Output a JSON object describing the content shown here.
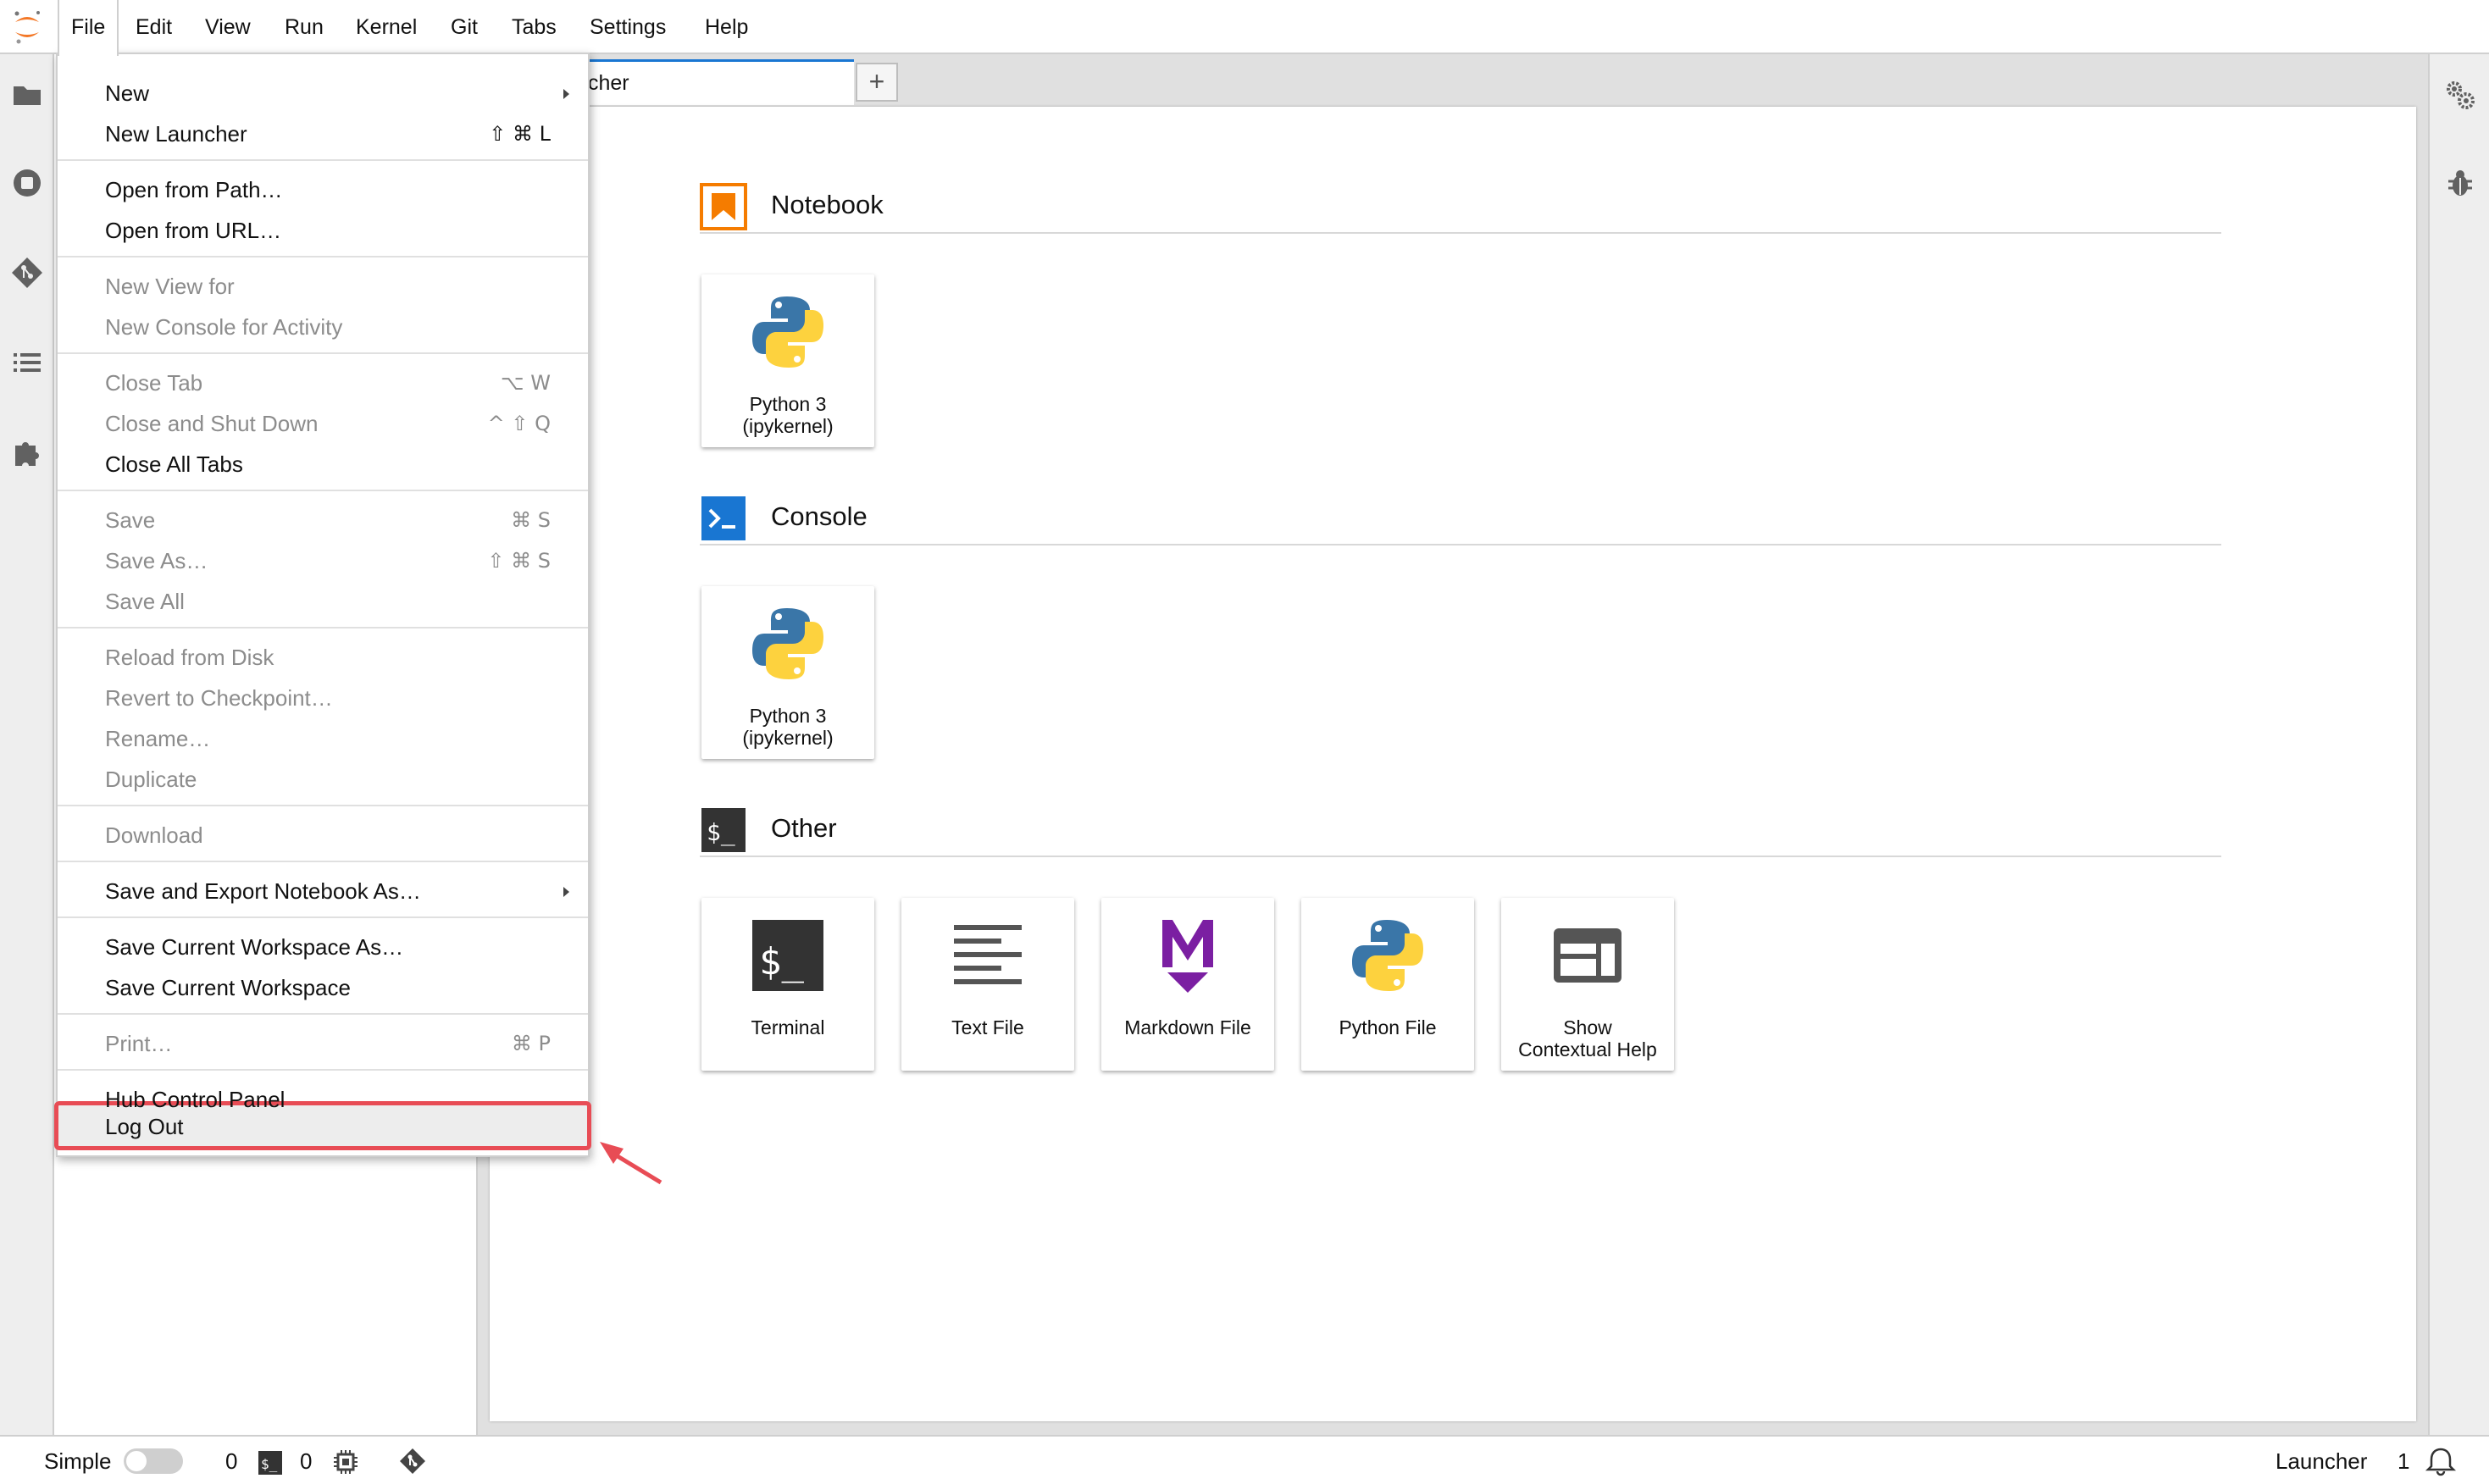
{
  "menubar": {
    "items": [
      "File",
      "Edit",
      "View",
      "Run",
      "Kernel",
      "Git",
      "Tabs",
      "Settings",
      "Help"
    ]
  },
  "tabs": {
    "launcher_label": "cher",
    "add_label": "+"
  },
  "launcher": {
    "sections": [
      {
        "title": "Notebook",
        "icon": "notebook-icon",
        "color": "#f57c00",
        "cards": [
          {
            "label_line1": "Python 3",
            "label_line2": "(ipykernel)",
            "icon": "python-logo"
          }
        ]
      },
      {
        "title": "Console",
        "icon": "console-icon",
        "color": "#1976d2",
        "cards": [
          {
            "label_line1": "Python 3",
            "label_line2": "(ipykernel)",
            "icon": "python-logo"
          }
        ]
      },
      {
        "title": "Other",
        "icon": "terminal-section-icon",
        "color": "#333333",
        "cards": [
          {
            "label_line1": "Terminal",
            "label_line2": "",
            "icon": "terminal-icon"
          },
          {
            "label_line1": "Text File",
            "label_line2": "",
            "icon": "text-file-icon"
          },
          {
            "label_line1": "Markdown File",
            "label_line2": "",
            "icon": "markdown-icon"
          },
          {
            "label_line1": "Python File",
            "label_line2": "",
            "icon": "python-logo"
          },
          {
            "label_line1": "Show",
            "label_line2": "Contextual Help",
            "icon": "contextual-help-icon"
          }
        ]
      }
    ]
  },
  "file_menu": {
    "items": [
      {
        "label": "New",
        "shortcut": "",
        "disabled": false,
        "submenu": true
      },
      {
        "label": "New Launcher",
        "shortcut": "⇧ ⌘ L",
        "disabled": false
      },
      {
        "label": "Open from Path…",
        "shortcut": "",
        "disabled": false
      },
      {
        "label": "Open from URL…",
        "shortcut": "",
        "disabled": false
      },
      {
        "label": "New View for",
        "shortcut": "",
        "disabled": true
      },
      {
        "label": "New Console for Activity",
        "shortcut": "",
        "disabled": true
      },
      {
        "label": "Close Tab",
        "shortcut": "⌥ W",
        "disabled": true
      },
      {
        "label": "Close and Shut Down",
        "shortcut": "^ ⇧ Q",
        "disabled": true
      },
      {
        "label": "Close All Tabs",
        "shortcut": "",
        "disabled": false
      },
      {
        "label": "Save",
        "shortcut": "⌘ S",
        "disabled": true
      },
      {
        "label": "Save As…",
        "shortcut": "⇧ ⌘ S",
        "disabled": true
      },
      {
        "label": "Save All",
        "shortcut": "",
        "disabled": true
      },
      {
        "label": "Reload from Disk",
        "shortcut": "",
        "disabled": true
      },
      {
        "label": "Revert to Checkpoint…",
        "shortcut": "",
        "disabled": true
      },
      {
        "label": "Rename…",
        "shortcut": "",
        "disabled": true
      },
      {
        "label": "Duplicate",
        "shortcut": "",
        "disabled": true
      },
      {
        "label": "Download",
        "shortcut": "",
        "disabled": true
      },
      {
        "label": "Save and Export Notebook As…",
        "shortcut": "",
        "disabled": false,
        "submenu": true
      },
      {
        "label": "Save Current Workspace As…",
        "shortcut": "",
        "disabled": false
      },
      {
        "label": "Save Current Workspace",
        "shortcut": "",
        "disabled": false
      },
      {
        "label": "Print…",
        "shortcut": "⌘ P",
        "disabled": true
      },
      {
        "label": "Hub Control Panel",
        "shortcut": "",
        "disabled": false
      },
      {
        "label": "Log Out",
        "shortcut": "",
        "disabled": false,
        "highlighted": true
      }
    ]
  },
  "statusbar": {
    "mode_label": "Simple",
    "terminals_count": "0",
    "kernels_count": "0",
    "launcher_label": "Launcher",
    "notifications_count": "1"
  },
  "colors": {
    "accent": "#1976d2",
    "highlight_border": "#e84c55",
    "disabled_text": "#8c8c8c"
  }
}
